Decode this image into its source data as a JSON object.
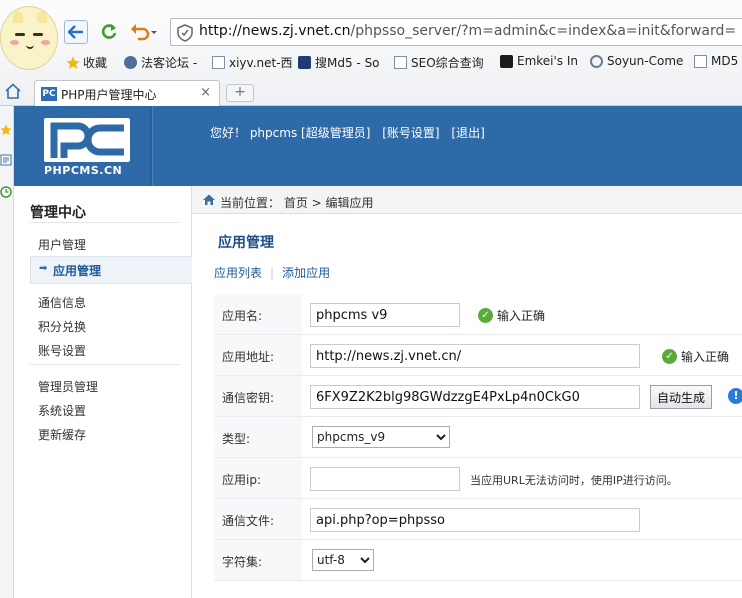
{
  "browser": {
    "url_host": "http://news.zj.vnet.cn",
    "url_path": "/phpsso_server/?m=admin&c=index&a=init&forward=",
    "bookmarks": [
      {
        "label": "收藏"
      },
      {
        "label": "法客论坛 -"
      },
      {
        "label": "xiyv.net-西"
      },
      {
        "label": "搜Md5 - So"
      },
      {
        "label": "SEO综合查询"
      },
      {
        "label": "Emkei's In"
      },
      {
        "label": "Soyun-Come"
      },
      {
        "label": "MD5"
      }
    ],
    "tab_title": "PHP用户管理中心",
    "tab_favicon": "PC",
    "tab_close": "×",
    "new_tab": "+"
  },
  "header": {
    "logo_text": "PHPCMS.CN",
    "greeting": "您好！ phpcms [超级管理员]",
    "account_settings": "[账号设置]",
    "logout": "[退出]"
  },
  "sidebar": {
    "title": "管理中心",
    "items": [
      {
        "label": "用户管理"
      },
      {
        "label": "应用管理"
      },
      {
        "label": "通信信息"
      },
      {
        "label": "积分兑换"
      },
      {
        "label": "账号设置"
      },
      {
        "label": "管理员管理"
      },
      {
        "label": "系统设置"
      },
      {
        "label": "更新缓存"
      }
    ],
    "active_marker": "➡"
  },
  "breadcrumb": {
    "text": "当前位置： 首页 > 编辑应用"
  },
  "main": {
    "title": "应用管理",
    "tabs": [
      {
        "label": "应用列表"
      },
      {
        "label": "添加应用"
      }
    ],
    "form": {
      "app_name": {
        "label": "应用名:",
        "value": "phpcms v9",
        "status": "输入正确"
      },
      "app_url": {
        "label": "应用地址:",
        "value": "http://news.zj.vnet.cn/",
        "status": "输入正确"
      },
      "auth_key": {
        "label": "通信密钥:",
        "value": "6FX9Z2K2blg98GWdzzgE4PxLp4n0CkG0",
        "button": "自动生成"
      },
      "type": {
        "label": "类型:",
        "selected": "phpcms_v9"
      },
      "app_ip": {
        "label": "应用ip:",
        "value": "",
        "hint": "当应用URL无法访问时，使用IP进行访问。"
      },
      "api_file": {
        "label": "通信文件:",
        "value": "api.php?op=phpsso"
      },
      "charset": {
        "label": "字符集:",
        "selected": "utf-8"
      }
    }
  },
  "colors": {
    "header_bg": "#2f6aa8",
    "accent": "#1f5a97",
    "success": "#5aaa3c",
    "info": "#2a7ad8"
  }
}
